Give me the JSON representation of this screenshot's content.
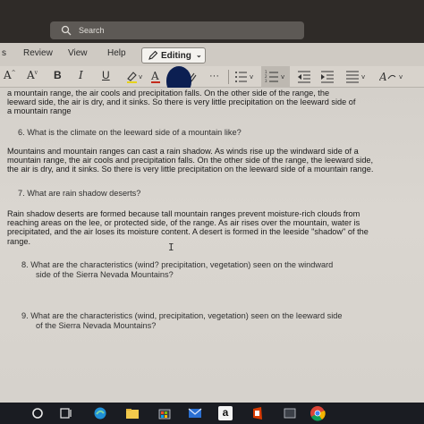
{
  "search": {
    "placeholder": "Search",
    "icon": "search-icon"
  },
  "ribbon": {
    "tabs": [
      {
        "label": "s"
      },
      {
        "label": "Review"
      },
      {
        "label": "View"
      },
      {
        "label": "Help"
      }
    ],
    "mode_label": "Editing"
  },
  "toolbar": {
    "grow_font": "A",
    "shrink_font": "A",
    "bold": "B",
    "italic": "I",
    "underline": "U",
    "more": "···"
  },
  "document": {
    "top_fragment": [
      "a mountain range, the air cools and precipitation falls. On the other side of the range, the",
      "leeward side, the air is dry, and it sinks. So there is very little precipitation on the leeward side of",
      "a mountain range"
    ],
    "q6": "6.   What is the climate on the leeward side of a mountain like?",
    "a6": [
      "Mountains and mountain ranges can cast a rain shadow. As winds rise up the windward side of a",
      "mountain range, the air cools and precipitation falls. On the other side of the range, the leeward side,",
      "the air is dry, and it sinks. So there is very little precipitation on the leeward side of a mountain range."
    ],
    "q7": "7.   What are rain shadow deserts?",
    "a7": [
      "Rain shadow deserts are formed because tall mountain ranges prevent moisture-rich clouds from",
      "reaching areas on the lee, or protected side, of the range. As air rises over the mountain, water is",
      "precipitated, and the air loses its moisture content. A desert is formed in the leeside \"shadow\" of the",
      "range."
    ],
    "q8": [
      "8.   What are the characteristics (wind? precipitation, vegetation) seen on the windward",
      "side of the Sierra Nevada Mountains?"
    ],
    "q9": [
      "9.   What are the characteristics (wind, precipitation, vegetation) seen on the leeward side",
      "of the Sierra Nevada Mountains?"
    ]
  },
  "taskbar": {
    "icons": [
      "start-icon",
      "task-view-icon",
      "edge-icon",
      "explorer-icon",
      "store-icon",
      "mail-icon",
      "amazon-icon",
      "office-icon",
      "chrome-icon"
    ],
    "amazon_letter": "a"
  },
  "colors": {
    "accent": "#0b3b8c",
    "taskbar": "#1a1c22",
    "titlebar": "#2f2b28"
  }
}
